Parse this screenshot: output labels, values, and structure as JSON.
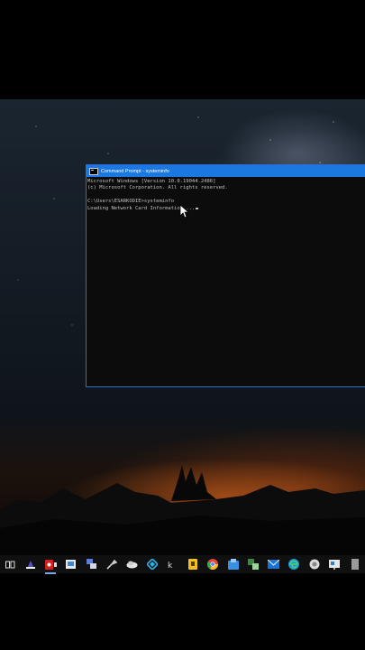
{
  "window": {
    "title": "Command Prompt - systeminfo",
    "console_lines": [
      "Microsoft Windows [Version 10.0.19044.2486]",
      "(c) Microsoft Corporation. All rights reserved.",
      "",
      "C:\\Users\\ESARKODIE>systeminfo",
      "Loading Network Card Information ..."
    ]
  },
  "taskbar": {
    "icons": [
      "task-view-icon",
      "app-icon",
      "screen-recorder-icon",
      "app-icon",
      "network-icon",
      "tool-icon",
      "cloud-icon",
      "kodi-icon",
      "app-icon",
      "app-icon",
      "chrome-icon",
      "app-icon",
      "app-icon",
      "mail-icon",
      "edge-icon",
      "app-icon",
      "app-icon",
      "app-icon"
    ]
  }
}
